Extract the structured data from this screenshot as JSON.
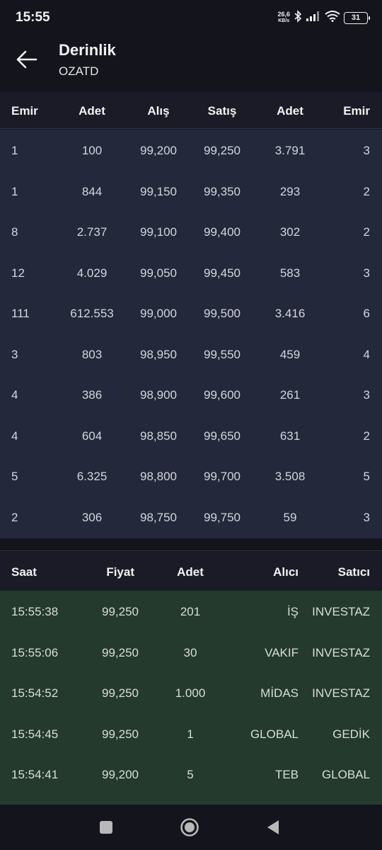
{
  "status_bar": {
    "time": "15:55",
    "net_speed_value": "26,6",
    "net_speed_unit": "KB/s",
    "battery": "31",
    "icons": [
      "bluetooth-icon",
      "signal-icon",
      "wifi-icon",
      "battery-icon"
    ]
  },
  "header": {
    "title": "Derinlik",
    "subtitle": "OZATD",
    "back_icon": "arrow-left-icon"
  },
  "depth": {
    "headers": [
      "Emir",
      "Adet",
      "Alış",
      "Satış",
      "Adet",
      "Emir"
    ],
    "rows": [
      [
        "1",
        "100",
        "99,200",
        "99,250",
        "3.791",
        "3"
      ],
      [
        "1",
        "844",
        "99,150",
        "99,350",
        "293",
        "2"
      ],
      [
        "8",
        "2.737",
        "99,100",
        "99,400",
        "302",
        "2"
      ],
      [
        "12",
        "4.029",
        "99,050",
        "99,450",
        "583",
        "3"
      ],
      [
        "111",
        "612.553",
        "99,000",
        "99,500",
        "3.416",
        "6"
      ],
      [
        "3",
        "803",
        "98,950",
        "99,550",
        "459",
        "4"
      ],
      [
        "4",
        "386",
        "98,900",
        "99,600",
        "261",
        "3"
      ],
      [
        "4",
        "604",
        "98,850",
        "99,650",
        "631",
        "2"
      ],
      [
        "5",
        "6.325",
        "98,800",
        "99,700",
        "3.508",
        "5"
      ],
      [
        "2",
        "306",
        "98,750",
        "99,750",
        "59",
        "3"
      ]
    ]
  },
  "trades": {
    "headers": [
      "Saat",
      "Fiyat",
      "Adet",
      "Alıcı",
      "Satıcı"
    ],
    "rows": [
      [
        "15:55:38",
        "99,250",
        "201",
        "İŞ",
        "INVESTAZ"
      ],
      [
        "15:55:06",
        "99,250",
        "30",
        "VAKIF",
        "INVESTAZ"
      ],
      [
        "15:54:52",
        "99,250",
        "1.000",
        "MİDAS",
        "INVESTAZ"
      ],
      [
        "15:54:45",
        "99,250",
        "1",
        "GLOBAL",
        "GEDİK"
      ],
      [
        "15:54:41",
        "99,200",
        "5",
        "TEB",
        "GLOBAL"
      ]
    ]
  },
  "nav": {
    "buttons": [
      "recent-apps-icon",
      "home-icon",
      "back-triangle-icon"
    ]
  },
  "colors": {
    "background": "#14141c",
    "depth_body": "#23283a",
    "trades_body": "#233a2c",
    "header_band": "#1b1b27"
  }
}
